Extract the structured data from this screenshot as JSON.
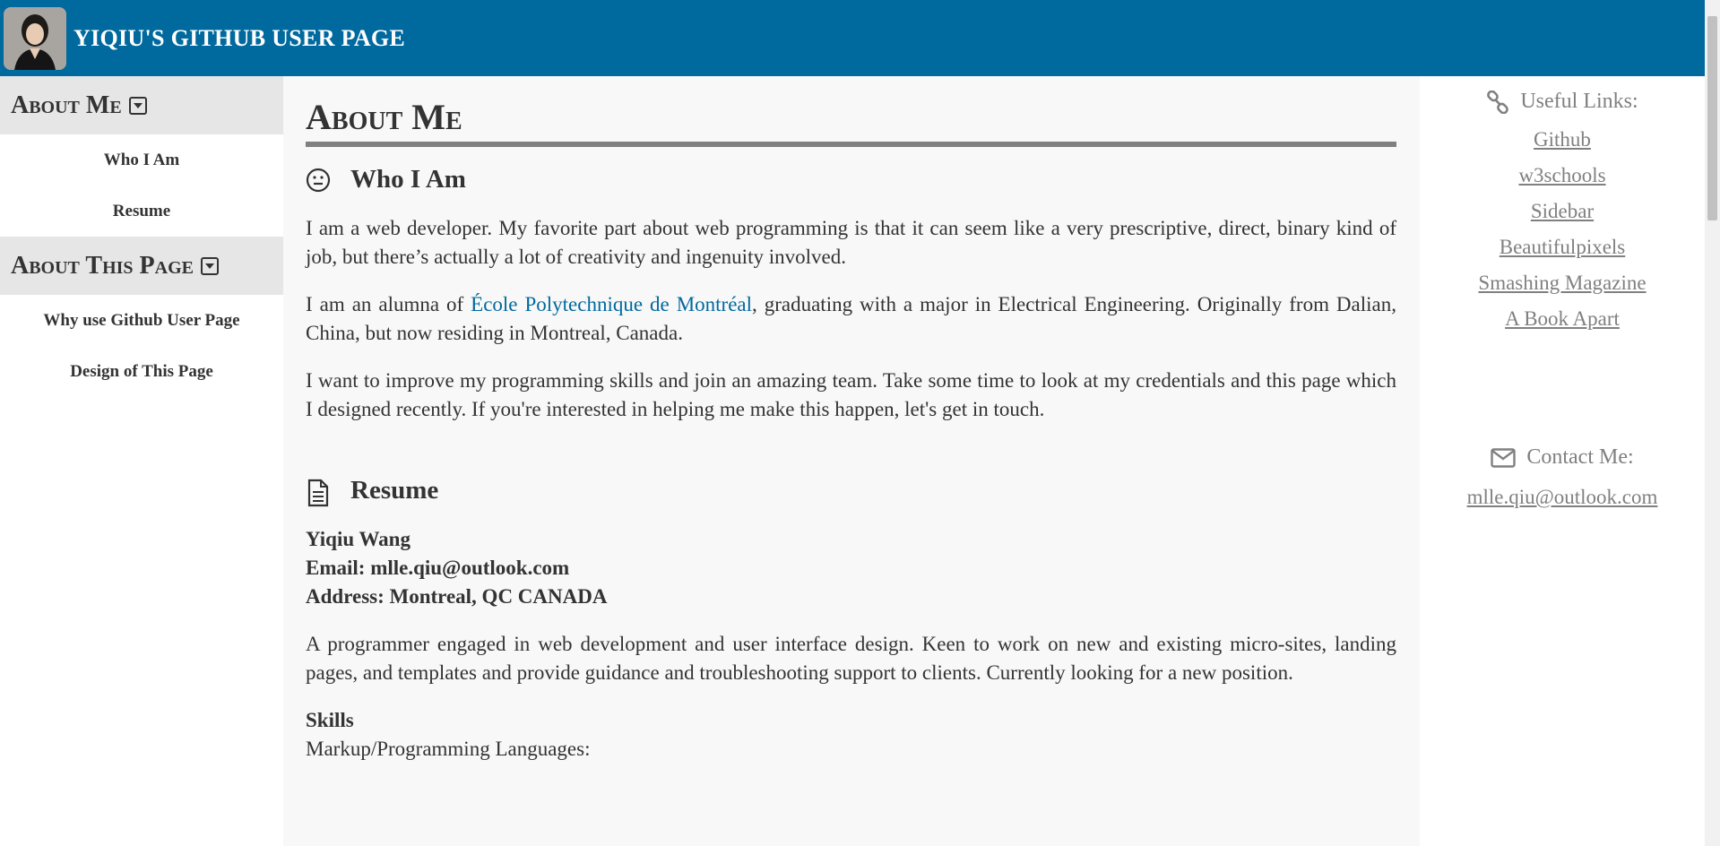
{
  "header": {
    "title": "YIQIU'S GITHUB USER PAGE"
  },
  "sidebar": {
    "sections": [
      {
        "label": "About Me",
        "items": [
          "Who I Am",
          "Resume"
        ]
      },
      {
        "label": "About This Page",
        "items": [
          "Why use Github User Page",
          "Design of This Page"
        ]
      }
    ]
  },
  "main": {
    "heading": "About Me",
    "who": {
      "title": "Who I Am",
      "p1": "I am a web developer. My favorite part about web programming is that it can seem like a very prescriptive, direct, binary kind of job, but there’s actually a lot of creativity and ingenuity involved.",
      "p2_before": "I am an alumna of ",
      "p2_link": "École Polytechnique de Montréal",
      "p2_after": ", graduating with a major in Electrical Engineering. Originally from Dalian, China, but now residing in Montreal, Canada.",
      "p3": "I want to improve my programming skills and join an amazing team. Take some time to look at my credentials and this page which I designed recently. If you're interested in helping me make this happen, let's get in touch."
    },
    "resume": {
      "title": "Resume",
      "name": "Yiqiu Wang",
      "email": "Email: mlle.qiu@outlook.com",
      "address": "Address: Montreal, QC CANADA",
      "summary": "A programmer engaged in web development and user interface design. Keen to work on new and existing micro-sites, landing pages, and templates and provide guidance and troubleshooting support to clients. Currently looking for a new position.",
      "skills_title": "Skills",
      "skills_line": "Markup/Programming Languages:"
    }
  },
  "rightbar": {
    "links_title": "Useful Links:",
    "links": [
      "Github",
      "w3schools",
      "Sidebar",
      "Beautifulpixels",
      "Smashing Magazine",
      "A Book Apart"
    ],
    "contact_title": "Contact Me:",
    "contact_email": "mlle.qiu@outlook.com"
  },
  "colors": {
    "header_bg": "#00699e",
    "sidebar_head_bg": "#e6e6e6",
    "main_bg": "#f8f8f8",
    "link": "#00699e",
    "muted": "#808080"
  },
  "icons": {
    "caret": "caret-square-down-icon",
    "who": "smile-face-icon",
    "resume": "document-icon",
    "links": "link-chain-icon",
    "contact": "envelope-icon"
  }
}
